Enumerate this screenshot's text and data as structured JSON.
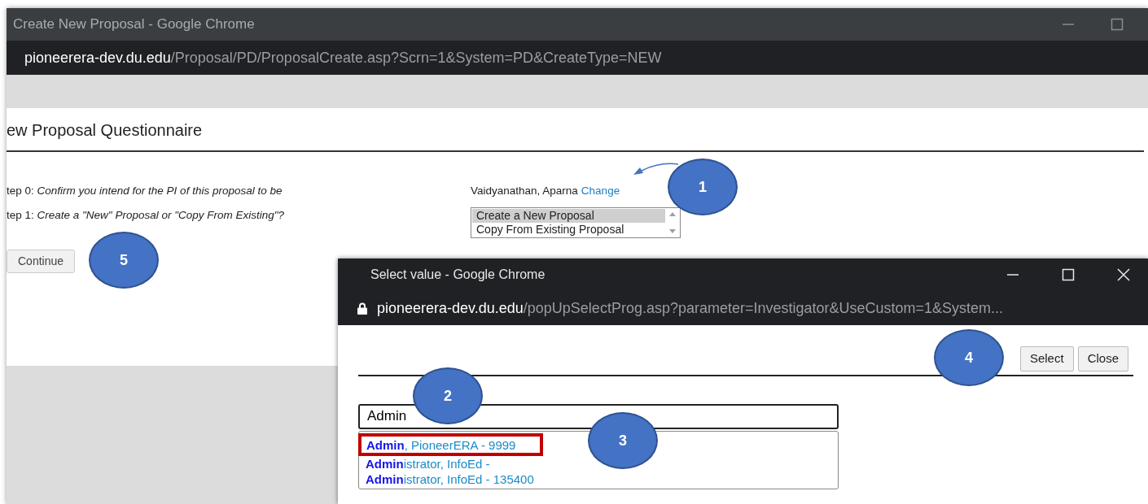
{
  "main_window": {
    "title": "Create New Proposal - Google Chrome",
    "url": {
      "host": "pioneerera-dev.du.edu",
      "path": "/Proposal/PD/ProposalCreate.asp?Scrn=1&System=PD&CreateType=NEW"
    }
  },
  "page": {
    "heading": "ew Proposal Questionnaire",
    "steps": [
      {
        "label": "tep 0: *Confirm you intend for the PI of this proposal to be*",
        "kind": "text",
        "value": "Vaidyanathan, Aparna",
        "link": "Change"
      },
      {
        "label": "tep 1: *Create a \"New\" Proposal or \"Copy From Existing\"?*",
        "kind": "listbox",
        "options": [
          {
            "label": "Create a New Proposal",
            "selected": true
          },
          {
            "label": "Copy From Existing Proposal",
            "selected": false
          }
        ]
      }
    ],
    "continue_button": "Continue"
  },
  "popup": {
    "title": "Select value - Google Chrome",
    "url": {
      "host": "pioneerera-dev.du.edu",
      "path": "/popUpSelectProg.asp?parameter=Investigator&UseCustom=1&System..."
    },
    "buttons": [
      "Select",
      "Close"
    ],
    "search": {
      "value": "Admin"
    },
    "suggestions": [
      {
        "text": "**Admin**, PioneerERA - 9999",
        "highlighted": true
      },
      {
        "text": "**Admin**istrator, InfoEd -",
        "highlighted": false
      },
      {
        "text": "**Admin**istrator, InfoEd - 135400",
        "highlighted": false
      }
    ]
  },
  "callouts": [
    {
      "number": "1"
    },
    {
      "number": "5"
    },
    {
      "number": "4"
    },
    {
      "number": "2"
    },
    {
      "number": "3"
    }
  ]
}
